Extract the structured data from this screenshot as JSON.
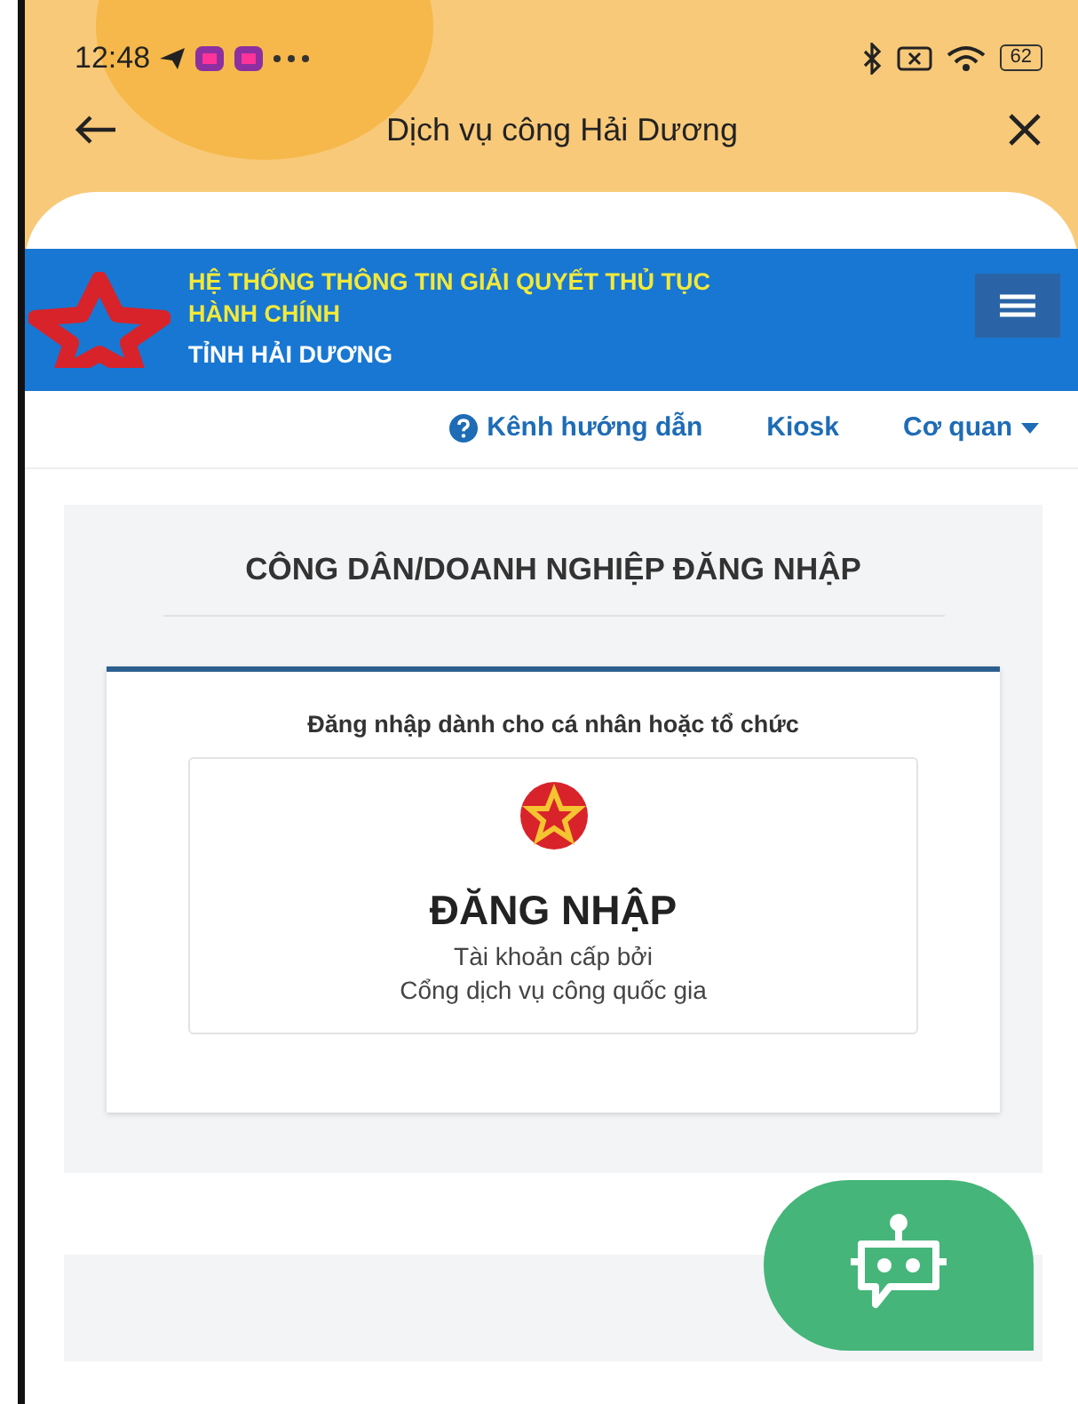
{
  "status_bar": {
    "time": "12:48",
    "battery": "62"
  },
  "app_bar": {
    "title": "Dịch vụ công Hải Dương"
  },
  "banner": {
    "title": "HỆ THỐNG THÔNG TIN GIẢI QUYẾT THỦ TỤC HÀNH CHÍNH",
    "subtitle": "TỈNH HẢI DƯƠNG"
  },
  "nav": [
    {
      "label": "Kênh hướng dẫn",
      "kind": "help"
    },
    {
      "label": "Kiosk",
      "kind": "plain"
    },
    {
      "label": "Cơ quan",
      "kind": "dropdown"
    }
  ],
  "login_panel": {
    "title": "CÔNG DÂN/DOANH NGHIỆP ĐĂNG NHẬP",
    "subtitle": "Đăng nhập dành cho cá nhân hoặc tổ chức",
    "button": {
      "title": "ĐĂNG NHẬP",
      "caption": [
        "Tài khoản cấp bởi",
        "Cổng dịch vụ công quốc gia"
      ]
    }
  }
}
